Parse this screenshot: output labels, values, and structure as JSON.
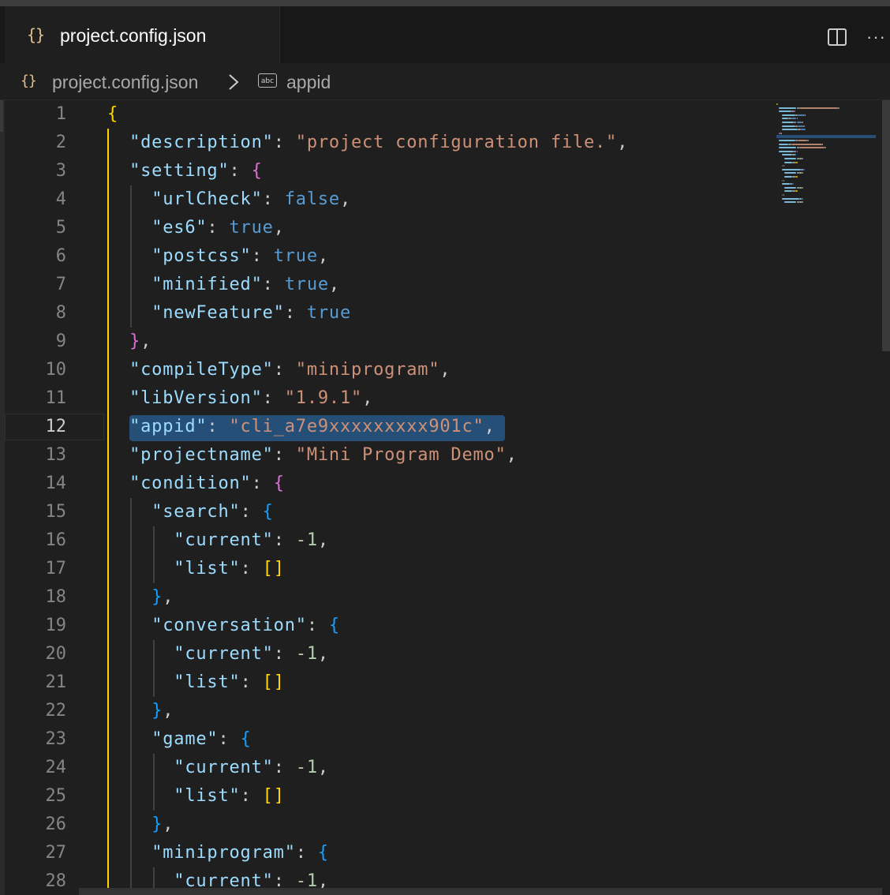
{
  "tab": {
    "icon": "json-braces-icon",
    "braces": "{}",
    "title": "project.config.json"
  },
  "toolbar": {
    "split_icon": "split-editor-icon",
    "more": "···"
  },
  "breadcrumb": {
    "file_icon": "json-braces-icon",
    "file": "project.config.json",
    "separator_icon": "chevron-right-icon",
    "symbol_icon": "string-symbol-icon",
    "symbol_badge": "abc",
    "symbol": "appid"
  },
  "editor": {
    "active_line": 12,
    "line_numbers": [
      "1",
      "2",
      "3",
      "4",
      "5",
      "6",
      "7",
      "8",
      "9",
      "10",
      "11",
      "12",
      "13",
      "14",
      "15",
      "16",
      "17",
      "18",
      "19",
      "20",
      "21",
      "22",
      "23",
      "24",
      "25",
      "26",
      "27",
      "28"
    ],
    "lines": [
      [
        [
          "{",
          "y"
        ]
      ],
      [
        [
          "  ",
          ""
        ],
        [
          "\"description\"",
          "k"
        ],
        [
          ": ",
          "p"
        ],
        [
          "\"project configuration file.\"",
          "s"
        ],
        [
          ",",
          "p"
        ]
      ],
      [
        [
          "  ",
          ""
        ],
        [
          "\"setting\"",
          "k"
        ],
        [
          ": ",
          "p"
        ],
        [
          "{",
          "m"
        ]
      ],
      [
        [
          "    ",
          ""
        ],
        [
          "\"urlCheck\"",
          "k"
        ],
        [
          ": ",
          "p"
        ],
        [
          "false",
          "b"
        ],
        [
          ",",
          "p"
        ]
      ],
      [
        [
          "    ",
          ""
        ],
        [
          "\"es6\"",
          "k"
        ],
        [
          ": ",
          "p"
        ],
        [
          "true",
          "b"
        ],
        [
          ",",
          "p"
        ]
      ],
      [
        [
          "    ",
          ""
        ],
        [
          "\"postcss\"",
          "k"
        ],
        [
          ": ",
          "p"
        ],
        [
          "true",
          "b"
        ],
        [
          ",",
          "p"
        ]
      ],
      [
        [
          "    ",
          ""
        ],
        [
          "\"minified\"",
          "k"
        ],
        [
          ": ",
          "p"
        ],
        [
          "true",
          "b"
        ],
        [
          ",",
          "p"
        ]
      ],
      [
        [
          "    ",
          ""
        ],
        [
          "\"newFeature\"",
          "k"
        ],
        [
          ": ",
          "p"
        ],
        [
          "true",
          "b"
        ]
      ],
      [
        [
          "  ",
          ""
        ],
        [
          "}",
          "m"
        ],
        [
          ",",
          "p"
        ]
      ],
      [
        [
          "  ",
          ""
        ],
        [
          "\"compileType\"",
          "k"
        ],
        [
          ": ",
          "p"
        ],
        [
          "\"miniprogram\"",
          "s"
        ],
        [
          ",",
          "p"
        ]
      ],
      [
        [
          "  ",
          ""
        ],
        [
          "\"libVersion\"",
          "k"
        ],
        [
          ": ",
          "p"
        ],
        [
          "\"1.9.1\"",
          "s"
        ],
        [
          ",",
          "p"
        ]
      ],
      [
        [
          "  ",
          ""
        ],
        [
          "\"appid\"",
          "k"
        ],
        [
          ": ",
          "p"
        ],
        [
          "\"cli_a7e9xxxxxxxxx901c\"",
          "s"
        ],
        [
          ",",
          "p"
        ]
      ],
      [
        [
          "  ",
          ""
        ],
        [
          "\"projectname\"",
          "k"
        ],
        [
          ": ",
          "p"
        ],
        [
          "\"Mini Program Demo\"",
          "s"
        ],
        [
          ",",
          "p"
        ]
      ],
      [
        [
          "  ",
          ""
        ],
        [
          "\"condition\"",
          "k"
        ],
        [
          ": ",
          "p"
        ],
        [
          "{",
          "m"
        ]
      ],
      [
        [
          "    ",
          ""
        ],
        [
          "\"search\"",
          "k"
        ],
        [
          ": ",
          "p"
        ],
        [
          "{",
          "bl"
        ]
      ],
      [
        [
          "      ",
          ""
        ],
        [
          "\"current\"",
          "k"
        ],
        [
          ": ",
          "p"
        ],
        [
          "-1",
          "n"
        ],
        [
          ",",
          "p"
        ]
      ],
      [
        [
          "      ",
          ""
        ],
        [
          "\"list\"",
          "k"
        ],
        [
          ": ",
          "p"
        ],
        [
          "[]",
          "y"
        ]
      ],
      [
        [
          "    ",
          ""
        ],
        [
          "}",
          "bl"
        ],
        [
          ",",
          "p"
        ]
      ],
      [
        [
          "    ",
          ""
        ],
        [
          "\"conversation\"",
          "k"
        ],
        [
          ": ",
          "p"
        ],
        [
          "{",
          "bl"
        ]
      ],
      [
        [
          "      ",
          ""
        ],
        [
          "\"current\"",
          "k"
        ],
        [
          ": ",
          "p"
        ],
        [
          "-1",
          "n"
        ],
        [
          ",",
          "p"
        ]
      ],
      [
        [
          "      ",
          ""
        ],
        [
          "\"list\"",
          "k"
        ],
        [
          ": ",
          "p"
        ],
        [
          "[]",
          "y"
        ]
      ],
      [
        [
          "    ",
          ""
        ],
        [
          "}",
          "bl"
        ],
        [
          ",",
          "p"
        ]
      ],
      [
        [
          "    ",
          ""
        ],
        [
          "\"game\"",
          "k"
        ],
        [
          ": ",
          "p"
        ],
        [
          "{",
          "bl"
        ]
      ],
      [
        [
          "      ",
          ""
        ],
        [
          "\"current\"",
          "k"
        ],
        [
          ": ",
          "p"
        ],
        [
          "-1",
          "n"
        ],
        [
          ",",
          "p"
        ]
      ],
      [
        [
          "      ",
          ""
        ],
        [
          "\"list\"",
          "k"
        ],
        [
          ": ",
          "p"
        ],
        [
          "[]",
          "y"
        ]
      ],
      [
        [
          "    ",
          ""
        ],
        [
          "}",
          "bl"
        ],
        [
          ",",
          "p"
        ]
      ],
      [
        [
          "    ",
          ""
        ],
        [
          "\"miniprogram\"",
          "k"
        ],
        [
          ": ",
          "p"
        ],
        [
          "{",
          "bl"
        ]
      ],
      [
        [
          "      ",
          ""
        ],
        [
          "\"current\"",
          "k"
        ],
        [
          ": ",
          "p"
        ],
        [
          "-1",
          "n"
        ],
        [
          ",",
          "p"
        ]
      ]
    ]
  }
}
